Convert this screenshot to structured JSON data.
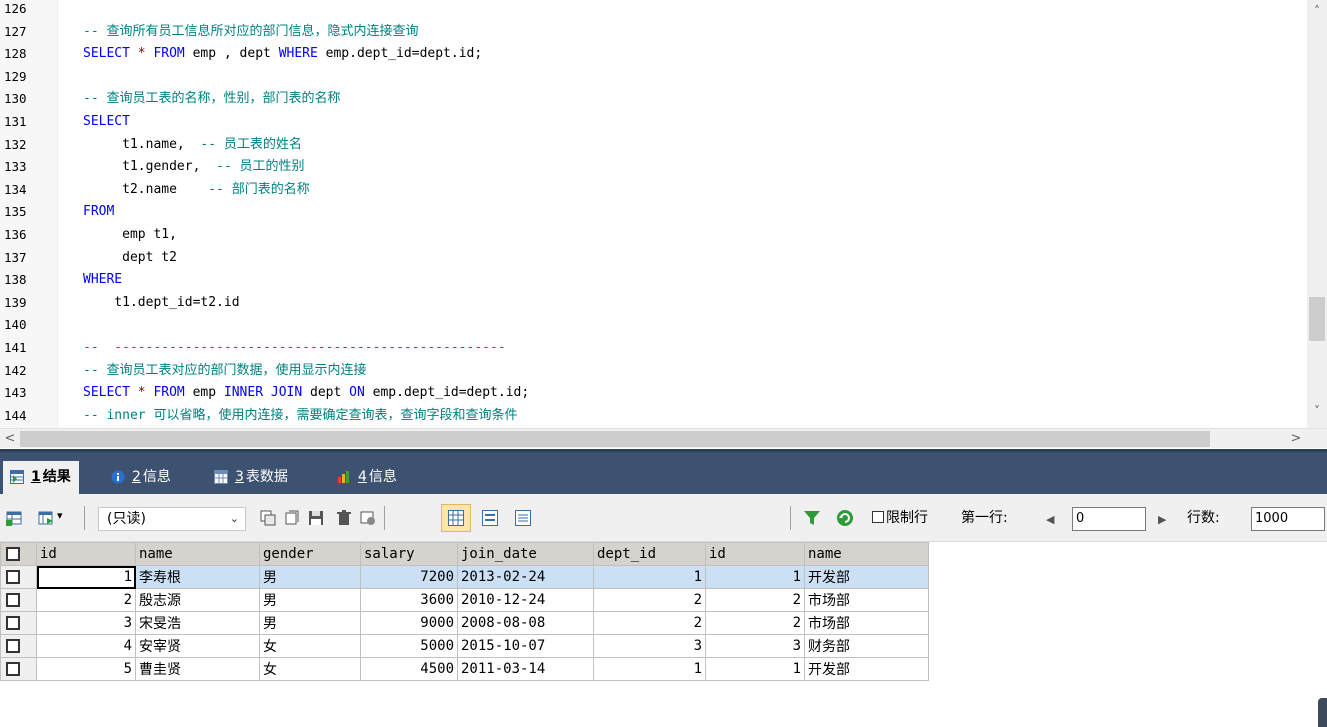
{
  "editor": {
    "lines": [
      {
        "num": "126",
        "segments": []
      },
      {
        "num": "127",
        "segments": [
          {
            "t": "-- 查询所有员工信息所对应的部门信息，隐式内连接查询",
            "c": "comment"
          }
        ]
      },
      {
        "num": "128",
        "segments": [
          {
            "t": "SELECT",
            "c": "keyword"
          },
          {
            "t": " * ",
            "c": "symbol"
          },
          {
            "t": "FROM",
            "c": "keyword"
          },
          {
            "t": " emp , dept ",
            "c": "plain"
          },
          {
            "t": "WHERE",
            "c": "keyword"
          },
          {
            "t": " emp.dept_id=dept.id;",
            "c": "plain"
          }
        ]
      },
      {
        "num": "129",
        "segments": []
      },
      {
        "num": "130",
        "segments": [
          {
            "t": "-- 查询员工表的名称，性别，部门表的名称",
            "c": "comment"
          }
        ]
      },
      {
        "num": "131",
        "segments": [
          {
            "t": "SELECT",
            "c": "keyword"
          }
        ]
      },
      {
        "num": "132",
        "segments": [
          {
            "t": "     t1.name,  ",
            "c": "plain"
          },
          {
            "t": "-- 员工表的姓名",
            "c": "comment"
          }
        ]
      },
      {
        "num": "133",
        "segments": [
          {
            "t": "     t1.gender,  ",
            "c": "plain"
          },
          {
            "t": "-- 员工的性别",
            "c": "comment"
          }
        ]
      },
      {
        "num": "134",
        "segments": [
          {
            "t": "     t2.name    ",
            "c": "plain"
          },
          {
            "t": "-- 部门表的名称",
            "c": "comment"
          }
        ]
      },
      {
        "num": "135",
        "segments": [
          {
            "t": "FROM",
            "c": "keyword"
          }
        ]
      },
      {
        "num": "136",
        "segments": [
          {
            "t": "     emp t1,",
            "c": "plain"
          }
        ]
      },
      {
        "num": "137",
        "segments": [
          {
            "t": "     dept t2",
            "c": "plain"
          }
        ]
      },
      {
        "num": "138",
        "segments": [
          {
            "t": "WHERE",
            "c": "keyword"
          }
        ]
      },
      {
        "num": "139",
        "segments": [
          {
            "t": "    t1.dept_id=t2.id",
            "c": "plain"
          }
        ]
      },
      {
        "num": "140",
        "segments": []
      },
      {
        "num": "141",
        "segments": [
          {
            "t": "--  --------------------------------------------------",
            "c": "comment"
          }
        ]
      },
      {
        "num": "142",
        "segments": [
          {
            "t": "-- 查询员工表对应的部门数据，使用显示内连接",
            "c": "comment"
          }
        ]
      },
      {
        "num": "143",
        "segments": [
          {
            "t": "SELECT",
            "c": "keyword"
          },
          {
            "t": " * ",
            "c": "symbol"
          },
          {
            "t": "FROM",
            "c": "keyword"
          },
          {
            "t": " emp ",
            "c": "plain"
          },
          {
            "t": "INNER JOIN",
            "c": "keyword"
          },
          {
            "t": " dept ",
            "c": "plain"
          },
          {
            "t": "ON",
            "c": "keyword"
          },
          {
            "t": " emp.dept_id=dept.id;",
            "c": "plain"
          }
        ]
      },
      {
        "num": "144",
        "segments": [
          {
            "t": "-- inner 可以省略，使用内连接，需要确定查询表，查询字段和查询条件",
            "c": "comment"
          }
        ]
      }
    ]
  },
  "scrollbar": {
    "up": "˄",
    "down": "˅",
    "left": "<",
    "right": ">"
  },
  "tabs": [
    {
      "num": "1",
      "label": "结果",
      "icon": "grid-result-icon",
      "active": true
    },
    {
      "num": "2",
      "label": "信息",
      "icon": "info-icon",
      "active": false
    },
    {
      "num": "3",
      "label": "表数据",
      "icon": "table-data-icon",
      "active": false
    },
    {
      "num": "4",
      "label": "信息",
      "icon": "profiler-icon",
      "active": false
    }
  ],
  "toolbar": {
    "mode_select": "(只读)",
    "limit_label": "限制行",
    "first_row_label": "第一行:",
    "first_row_value": "0",
    "row_count_label": "行数:",
    "row_count_value": "1000"
  },
  "grid": {
    "columns": [
      "id",
      "name",
      "gender",
      "salary",
      "join_date",
      "dept_id",
      "id",
      "name"
    ],
    "rows": [
      [
        "1",
        "李寿根",
        "男",
        "7200",
        "2013-02-24",
        "1",
        "1",
        "开发部"
      ],
      [
        "2",
        "殷志源",
        "男",
        "3600",
        "2010-12-24",
        "2",
        "2",
        "市场部"
      ],
      [
        "3",
        "宋旻浩",
        "男",
        "9000",
        "2008-08-08",
        "2",
        "2",
        "市场部"
      ],
      [
        "4",
        "安宰贤",
        "女",
        "5000",
        "2015-10-07",
        "3",
        "3",
        "财务部"
      ],
      [
        "5",
        "曹圭贤",
        "女",
        "4500",
        "2011-03-14",
        "1",
        "1",
        "开发部"
      ]
    ],
    "selected_row": 0
  },
  "colors": {
    "tab_bar": "#3c5270",
    "comment": "#008080",
    "keyword": "#0000ff",
    "selected_row": "#cce0f5"
  }
}
